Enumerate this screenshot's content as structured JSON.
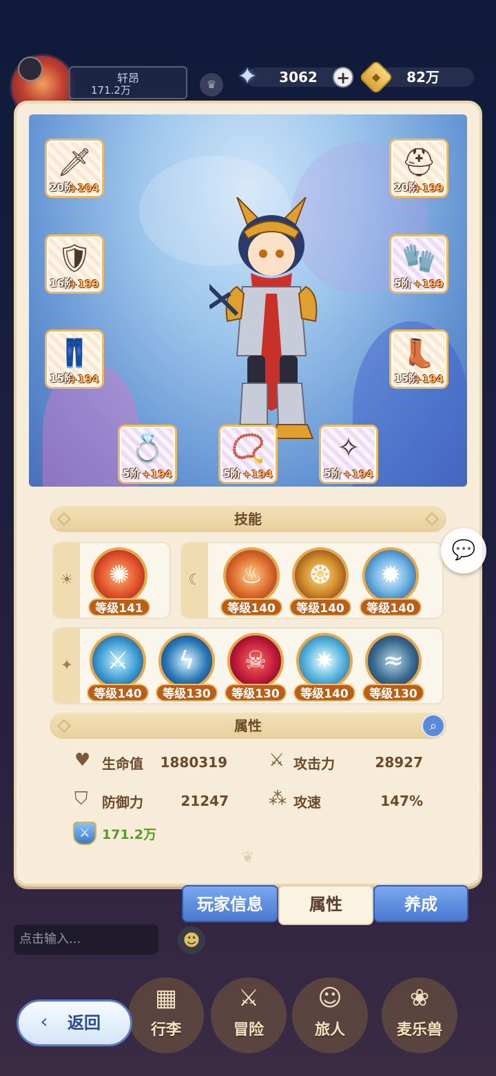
{
  "header": {
    "player_name": "轩昂",
    "player_power": "171.2万",
    "gem_amount": "3062",
    "gold_amount": "82万",
    "plus_label": "+"
  },
  "equipment": [
    {
      "id": "weapon",
      "tier": "20阶",
      "plus": "+204",
      "icon": "sword-icon"
    },
    {
      "id": "helmet",
      "tier": "20阶",
      "plus": "+199",
      "icon": "helmet-icon"
    },
    {
      "id": "armor",
      "tier": "16阶",
      "plus": "+199",
      "icon": "armor-icon"
    },
    {
      "id": "gloves",
      "tier": "5阶",
      "plus": "+199",
      "icon": "gauntlet-icon"
    },
    {
      "id": "pants",
      "tier": "15阶",
      "plus": "+194",
      "icon": "pants-icon"
    },
    {
      "id": "boots",
      "tier": "15阶",
      "plus": "+194",
      "icon": "boots-icon"
    },
    {
      "id": "ring",
      "tier": "5阶",
      "plus": "+194",
      "icon": "ring-icon"
    },
    {
      "id": "necklace",
      "tier": "5阶",
      "plus": "+194",
      "icon": "necklace-icon"
    },
    {
      "id": "amulet",
      "tier": "5阶",
      "plus": "+194",
      "icon": "amulet-icon"
    }
  ],
  "skills_section": {
    "title": "技能",
    "passive": [
      {
        "level": "等级141",
        "icon": "fire-burst-icon"
      }
    ],
    "active": [
      {
        "level": "等级140",
        "icon": "fire-warrior-icon"
      },
      {
        "level": "等级140",
        "icon": "flame-swirl-icon"
      },
      {
        "level": "等级140",
        "icon": "lion-roar-icon"
      }
    ],
    "ultimate": [
      {
        "level": "等级140",
        "icon": "ice-sword-icon"
      },
      {
        "level": "等级130",
        "icon": "lightning-icon"
      },
      {
        "level": "等级130",
        "icon": "demon-shadow-icon"
      },
      {
        "level": "等级140",
        "icon": "light-flash-icon"
      },
      {
        "level": "等级130",
        "icon": "dark-path-icon"
      }
    ]
  },
  "attributes_section": {
    "title": "属性",
    "hp_label": "生命值",
    "hp_value": "1880319",
    "atk_label": "攻击力",
    "atk_value": "28927",
    "def_label": "防御力",
    "def_value": "21247",
    "spd_label": "攻速",
    "spd_value": "147%",
    "power_value": "171.2万"
  },
  "tabs": {
    "player_info": "玩家信息",
    "attributes": "属性",
    "cultivate": "养成",
    "active": "attributes"
  },
  "chat": {
    "placeholder": "点击输入..."
  },
  "bottom_nav": {
    "back": "返回",
    "items": [
      "行李",
      "冒险",
      "旅人",
      "麦乐兽"
    ]
  },
  "colors": {
    "panel_bg": "#f6ecd9",
    "accent_gold": "#e9a64a",
    "tab_blue": "#4a78d0",
    "power_green": "#5a9a2a"
  }
}
